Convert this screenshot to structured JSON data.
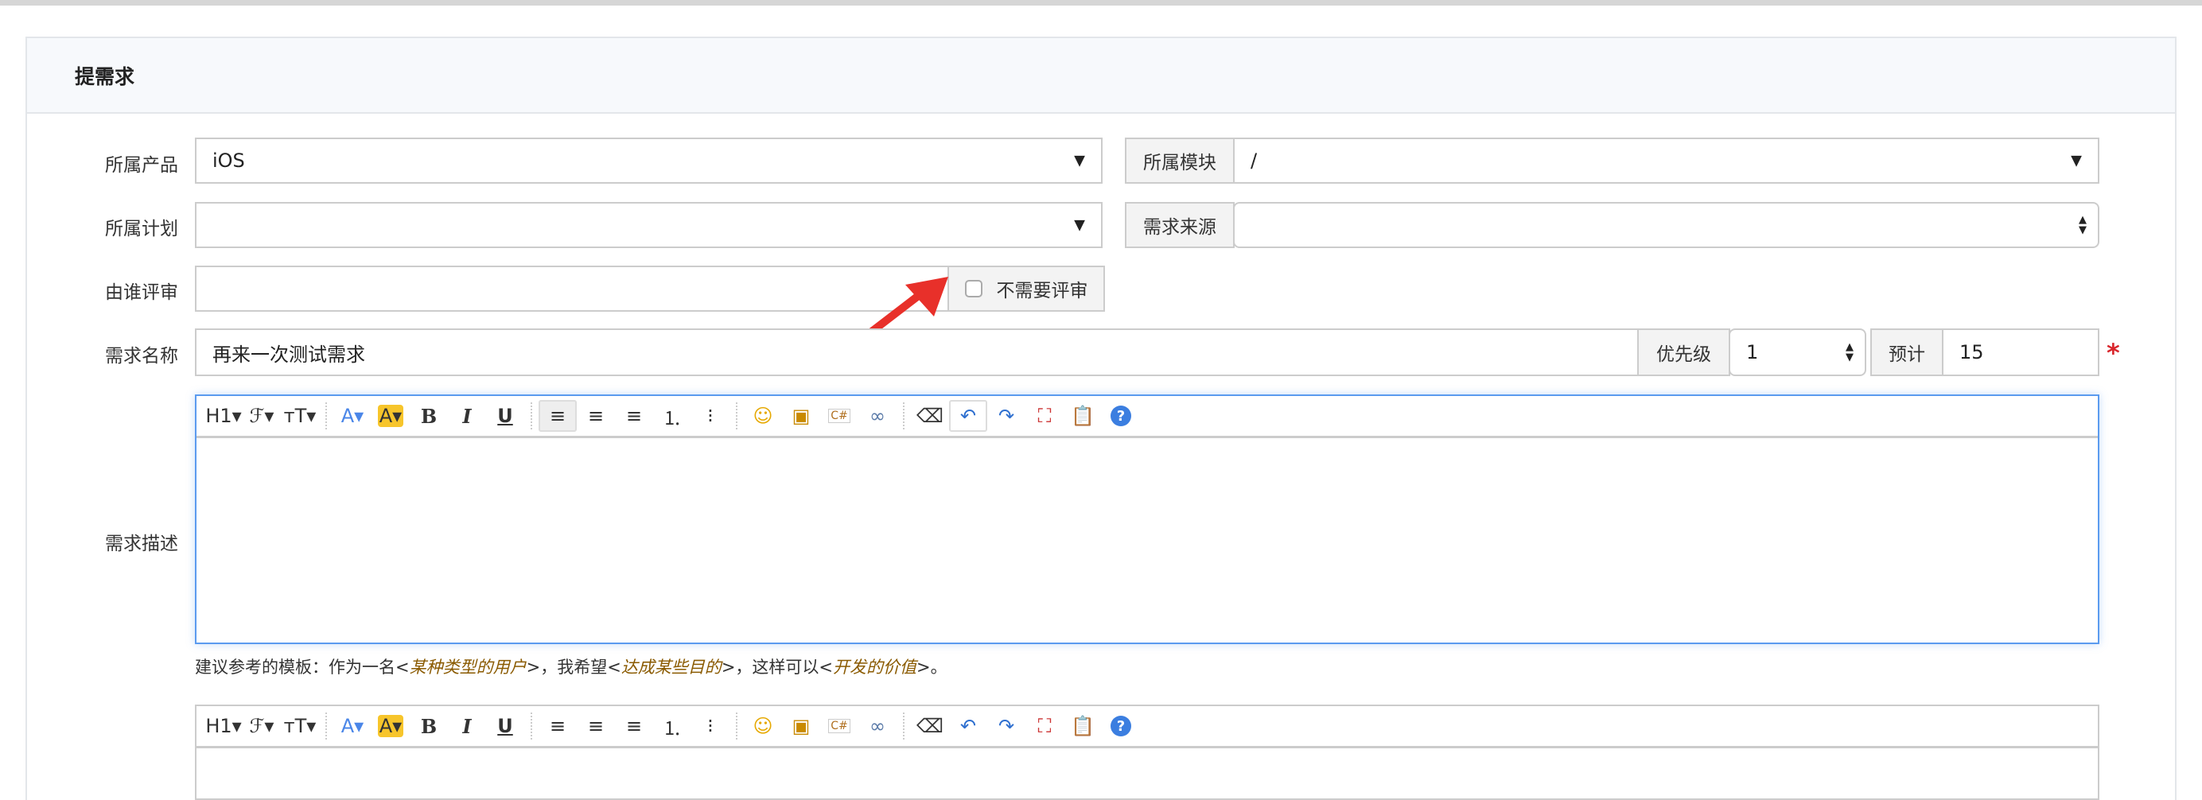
{
  "panel": {
    "title": "提需求"
  },
  "form": {
    "product": {
      "label": "所属产品",
      "value": "iOS"
    },
    "module": {
      "label": "所属模块",
      "value": "/"
    },
    "plan": {
      "label": "所属计划",
      "value": ""
    },
    "source": {
      "label": "需求来源",
      "value": ""
    },
    "reviewer": {
      "label": "由谁评审",
      "value": "",
      "no_review_label": "不需要评审"
    },
    "title": {
      "label": "需求名称",
      "value": "再来一次测试需求"
    },
    "priority": {
      "label": "优先级",
      "value": "1"
    },
    "estimate": {
      "label": "预计",
      "value": "15"
    },
    "required_mark": "*",
    "description": {
      "label": "需求描述"
    },
    "hint": {
      "prefix": "建议参考的模板：作为一名<",
      "user": "某种类型的用户",
      "mid1": ">，我希望<",
      "goal": "达成某些目的",
      "mid2": ">，这样可以<",
      "value": "开发的价值",
      "suffix": ">。"
    }
  },
  "toolbar": [
    "H1▾",
    "ℱ▾",
    "ᴛT▾",
    "A▾",
    "A▾",
    "B",
    "I",
    "U",
    "≡",
    "≡",
    "≡",
    "⒈",
    "⁝",
    "☺",
    "▣",
    "C#",
    "∞",
    "⌫",
    "↶",
    "↷",
    "⛶",
    "📋",
    "?"
  ],
  "colors": {
    "accent": "#5b9bef",
    "required": "#d9262c",
    "hint_emphasis": "#8a5a00"
  }
}
